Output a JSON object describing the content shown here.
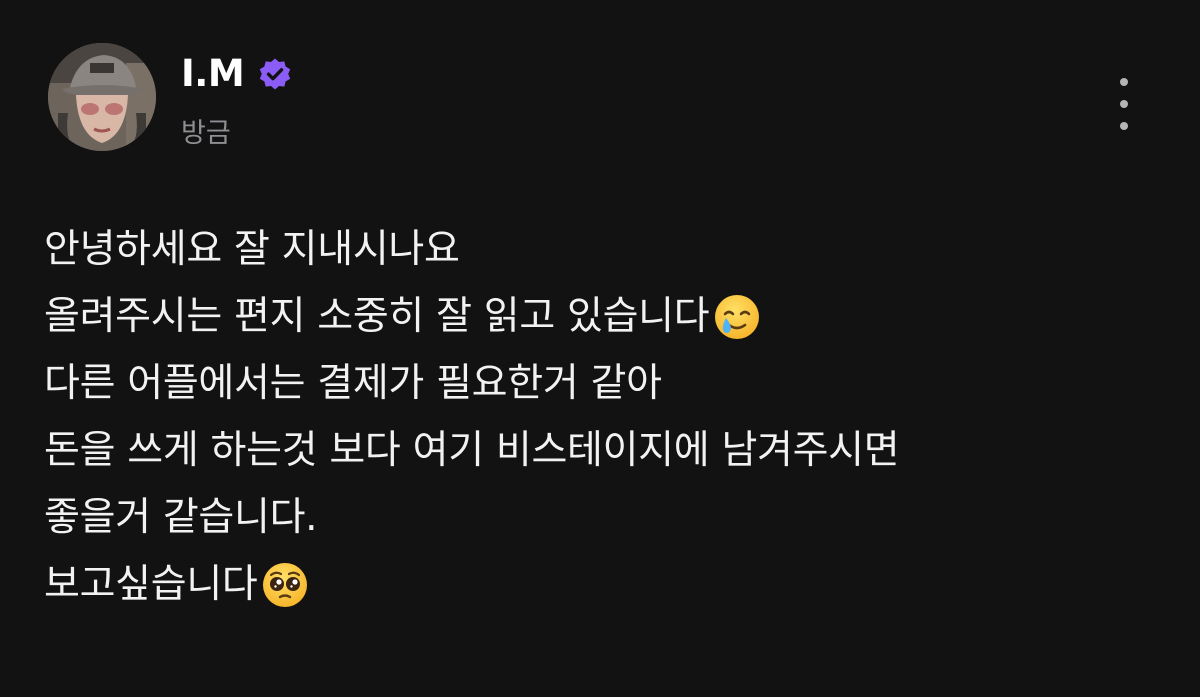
{
  "author": {
    "name": "I.M",
    "verified": true,
    "avatar": "avatar"
  },
  "timestamp": "방금",
  "menu": {
    "icon": "more-vertical-icon"
  },
  "body": {
    "lines": [
      {
        "text": "안녕하세요 잘 지내시나요",
        "emoji": ""
      },
      {
        "text": "올려주시는 편지 소중히 잘 읽고 있습니다",
        "emoji": "smiling-face-with-tear-icon"
      },
      {
        "text": "다른 어플에서는 결제가 필요한거 같아",
        "emoji": ""
      },
      {
        "text": "돈을 쓰게 하는것 보다 여기 비스테이지에 남겨주시면",
        "emoji": ""
      },
      {
        "text": "좋을거 같습니다.",
        "emoji": ""
      },
      {
        "text": "보고싶습니다",
        "emoji": "pleading-face-icon"
      }
    ]
  },
  "colors": {
    "background": "#121212",
    "text": "#f2f2f2",
    "muted": "#8e8e93",
    "verified": "#8b5cf6"
  }
}
